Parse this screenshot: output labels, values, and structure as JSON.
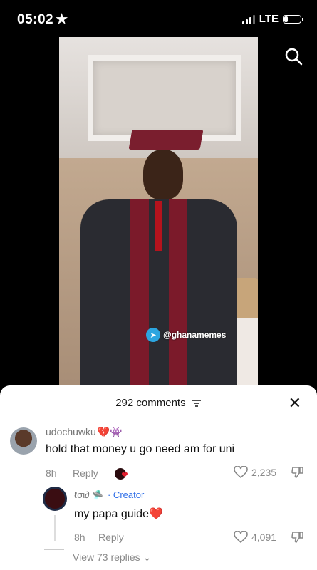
{
  "status_bar": {
    "time": "05:02",
    "network": "LTE",
    "battery_level": 0.25
  },
  "video": {
    "watermark": "@ghanamemes"
  },
  "comments_sheet": {
    "header": "292 comments",
    "comments": [
      {
        "username": "udochuwku",
        "emojis": "💔👾",
        "text": "hold that money u go need am for uni",
        "time": "8h",
        "reply_label": "Reply",
        "likes": "2,235"
      }
    ],
    "reply": {
      "username": "ℓσι∂",
      "badge": "· Creator",
      "text": "my papa guide❤️",
      "time": "8h",
      "reply_label": "Reply",
      "likes": "4,091"
    },
    "view_replies": "View 73 replies"
  },
  "icons": {
    "star": "star-icon",
    "search": "search-icon",
    "close": "close-icon",
    "filter": "filter-icon",
    "heart": "heart-icon",
    "dislike": "dislike-icon"
  },
  "colors": {
    "creator": "#2f6fe8",
    "telegram": "#2ca5e0",
    "heart_red": "#e11d2e"
  }
}
